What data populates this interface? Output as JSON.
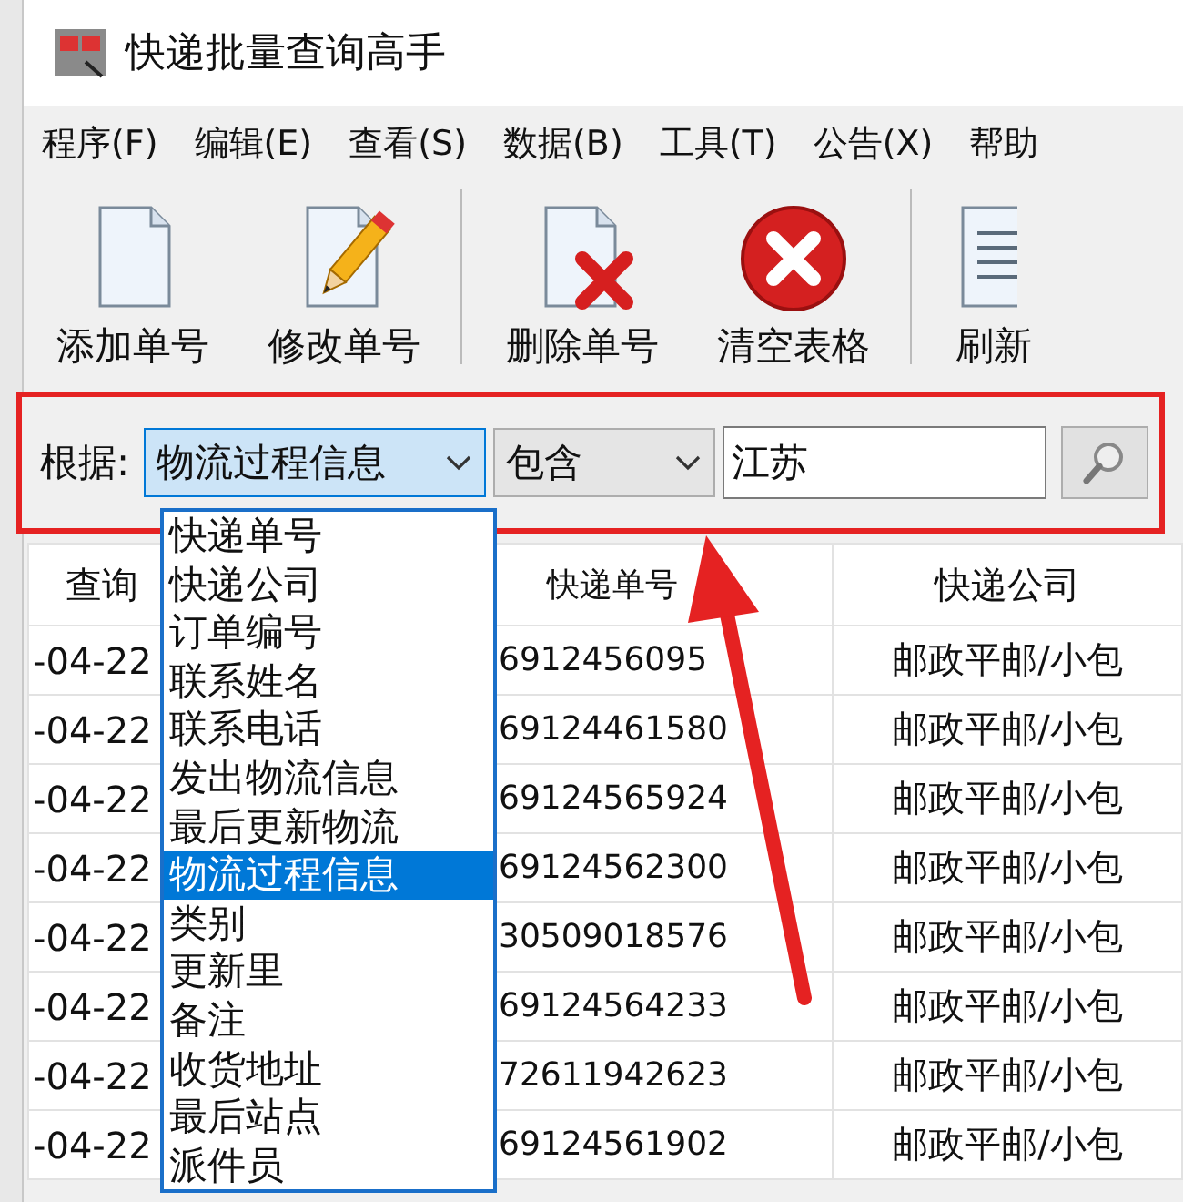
{
  "window": {
    "title": "快递批量查询高手"
  },
  "menu": [
    "程序(F)",
    "编辑(E)",
    "查看(S)",
    "数据(B)",
    "工具(T)",
    "公告(X)",
    "帮助"
  ],
  "toolbar": [
    {
      "kind": "add",
      "label": "添加单号"
    },
    {
      "kind": "edit",
      "label": "修改单号"
    },
    {
      "kind": "separator"
    },
    {
      "kind": "delete",
      "label": "删除单号"
    },
    {
      "kind": "clear",
      "label": "清空表格"
    },
    {
      "kind": "separator"
    },
    {
      "kind": "refresh",
      "label": "刷新"
    }
  ],
  "filter": {
    "label": "根据:",
    "field": {
      "value": "物流过程信息",
      "expanded": true
    },
    "operator": {
      "value": "包含"
    },
    "keyword": {
      "value": "江苏"
    }
  },
  "dropdown": {
    "items": [
      {
        "label": "快递单号",
        "selected": false
      },
      {
        "label": "快递公司",
        "selected": false
      },
      {
        "label": "订单编号",
        "selected": false
      },
      {
        "label": "联系姓名",
        "selected": false
      },
      {
        "label": "联系电话",
        "selected": false
      },
      {
        "label": "发出物流信息",
        "selected": false
      },
      {
        "label": "最后更新物流",
        "selected": false
      },
      {
        "label": "物流过程信息",
        "selected": true
      },
      {
        "label": "类别",
        "selected": false
      },
      {
        "label": "更新里",
        "selected": false
      },
      {
        "label": "备注",
        "selected": false
      },
      {
        "label": "收货地址",
        "selected": false
      },
      {
        "label": "最后站点",
        "selected": false
      },
      {
        "label": "派件员",
        "selected": false
      }
    ]
  },
  "table": {
    "columns": [
      "查询",
      "快递单号",
      "快递公司"
    ],
    "rows": [
      [
        "-04-22",
        "6912456095",
        "邮政平邮/小包"
      ],
      [
        "-04-22",
        "69124461580",
        "邮政平邮/小包"
      ],
      [
        "-04-22",
        "69124565924",
        "邮政平邮/小包"
      ],
      [
        "-04-22",
        "69124562300",
        "邮政平邮/小包"
      ],
      [
        "-04-22",
        "30509018576",
        "邮政平邮/小包"
      ],
      [
        "-04-22",
        "69124564233",
        "邮政平邮/小包"
      ],
      [
        "-04-22",
        "72611942623",
        "邮政平邮/小包"
      ],
      [
        "-04-22",
        "69124561902",
        "邮政平邮/小包"
      ]
    ]
  }
}
